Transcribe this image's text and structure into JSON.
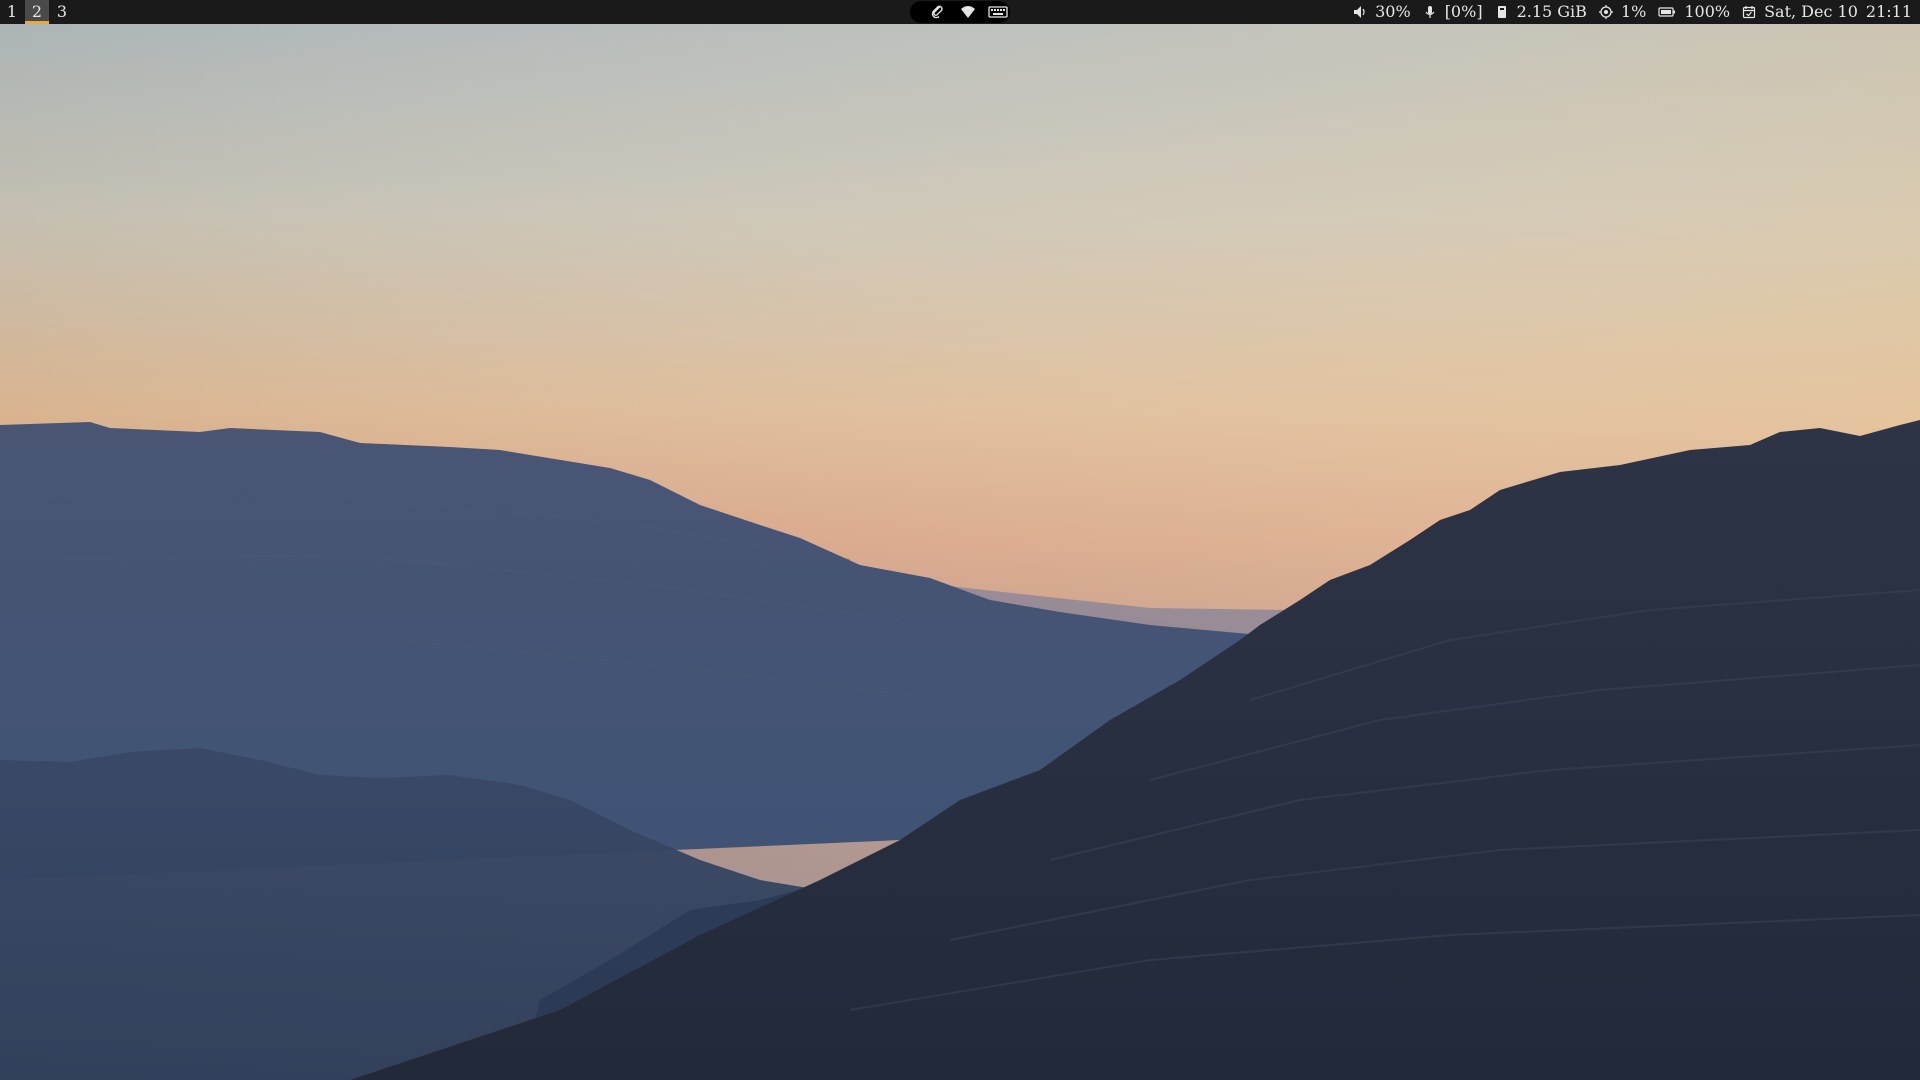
{
  "workspaces": [
    {
      "label": "1",
      "active": false
    },
    {
      "label": "2",
      "active": true
    },
    {
      "label": "3",
      "active": false
    }
  ],
  "tray": {
    "icons": [
      "paperclip-icon",
      "wifi-icon",
      "keyboard-icon"
    ]
  },
  "status": {
    "volume": "30%",
    "microphone": "[0%]",
    "memory": "2.15 GiB",
    "cpu": "1%",
    "battery": "100%",
    "date": "Sat, Dec 10",
    "time": "21:11"
  },
  "colors": {
    "bar_background": "#1a1a1a",
    "active_workspace_underline": "#f0a830",
    "text": "#e6e6e6"
  }
}
